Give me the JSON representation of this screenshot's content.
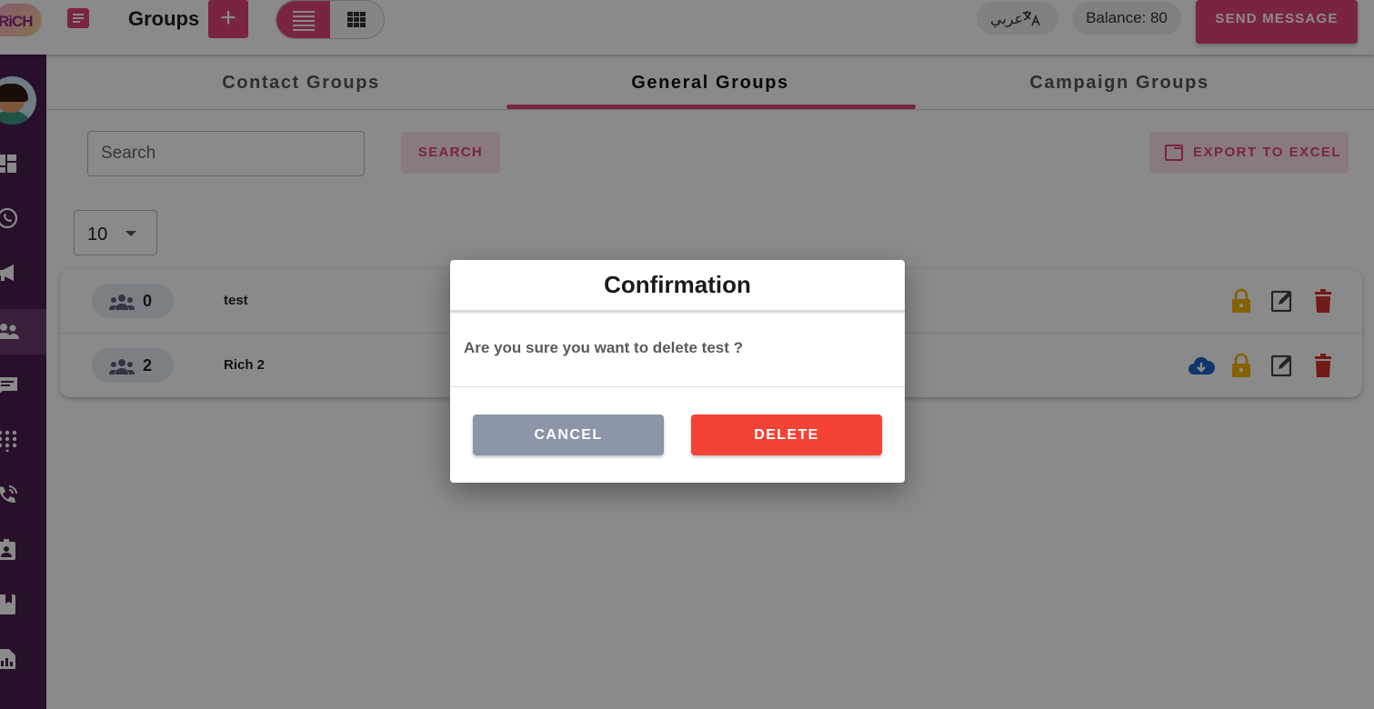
{
  "header": {
    "logo_text": "RiCH",
    "title": "Groups",
    "add_label": "+",
    "language_label": "عربي",
    "balance_label": "Balance: 80",
    "send_message_label": "SEND MESSAGE"
  },
  "tabs": [
    {
      "label": "Contact Groups",
      "active": false
    },
    {
      "label": "General Groups",
      "active": true
    },
    {
      "label": "Campaign Groups",
      "active": false
    }
  ],
  "toolbar": {
    "search_placeholder": "Search",
    "search_value": "",
    "search_button": "SEARCH",
    "export_button": "EXPORT TO EXCEL",
    "per_page": "10"
  },
  "groups": [
    {
      "count": "0",
      "name": "test",
      "actions": [
        "lock-icon",
        "edit-icon",
        "delete-icon"
      ]
    },
    {
      "count": "2",
      "name": "Rich 2",
      "actions": [
        "cloud-download-icon",
        "lock-icon",
        "edit-icon",
        "delete-icon"
      ]
    }
  ],
  "dialog": {
    "title": "Confirmation",
    "message": "Are you sure you want to delete test ?",
    "cancel_label": "CANCEL",
    "delete_label": "DELETE"
  },
  "colors": {
    "accent": "#e0457b",
    "sidebar": "#4a1f4f",
    "delete": "#f44336",
    "cancel": "#8c96a8",
    "lock": "#f5b301",
    "trash": "#d32f2f",
    "cloud": "#1e63c8"
  }
}
